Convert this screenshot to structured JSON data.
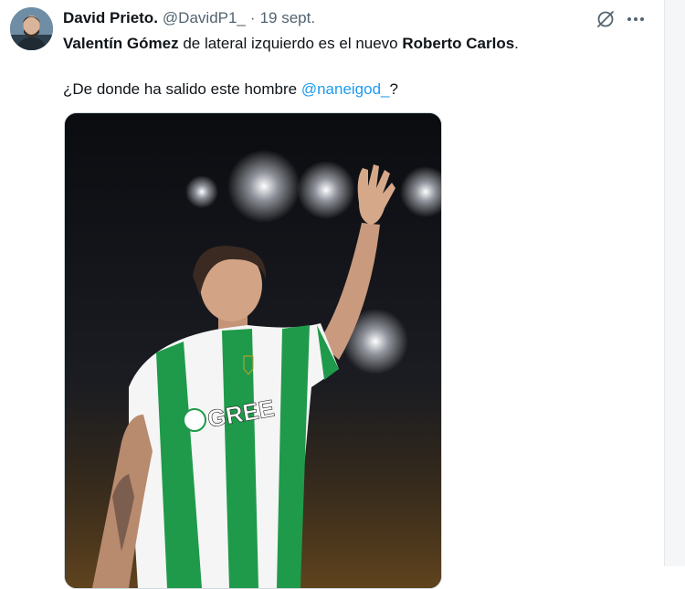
{
  "tweet": {
    "author": {
      "display_name": "David Prieto.",
      "handle": "@DavidP1_",
      "separator": "·",
      "date": "19 sept."
    },
    "text": {
      "line1": {
        "bold_1": "Valentín Gómez",
        "mid": " de lateral izquierdo es el nuevo ",
        "bold_2": "Roberto Carlos",
        "end": "."
      },
      "line2": {
        "prefix": "¿De donde ha salido este hombre ",
        "mention": "@naneigod_",
        "suffix": "?"
      }
    },
    "icons": [
      "avatar",
      "grok-icon",
      "more-icon"
    ],
    "media": {
      "shirt_sponsor": "GREE",
      "colors": {
        "shirt_green": "#1f9a4a",
        "shirt_white": "#f5f5f5",
        "background": "#0d0f12"
      }
    }
  },
  "colors": {
    "link": "#1d9bf0",
    "secondary_text": "#536471"
  }
}
